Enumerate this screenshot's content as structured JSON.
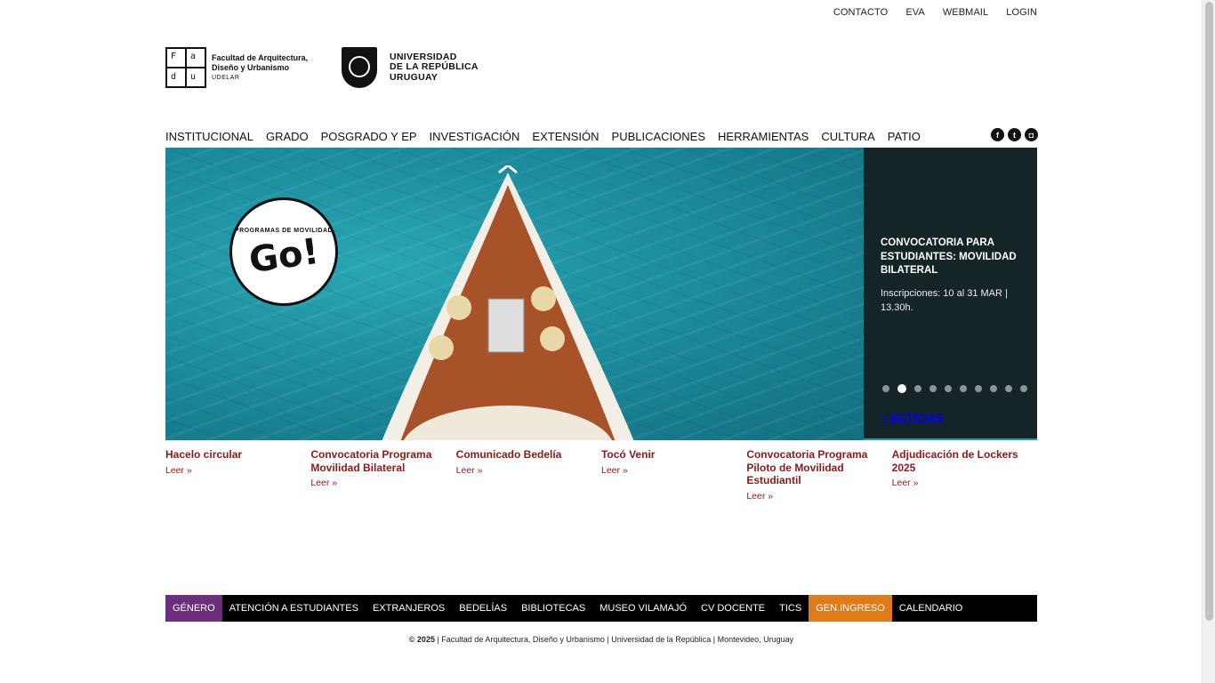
{
  "top_links": [
    "CONTACTO",
    "EVA",
    "WEBMAIL",
    "LOGIN"
  ],
  "logos": {
    "fadu_letters": [
      "F",
      "a",
      "d",
      "u"
    ],
    "fadu_name": "Facultad de Arquitectura, Diseño y Urbanismo",
    "fadu_sub": "UDELAR",
    "udelar_line1": "UNIVERSIDAD",
    "udelar_line2": "DE LA REPÚBLICA",
    "udelar_line3": "URUGUAY"
  },
  "main_nav": [
    "INSTITUCIONAL",
    "GRADO",
    "POSGRADO Y EP",
    "INVESTIGACIÓN",
    "EXTENSIÓN",
    "PUBLICACIONES",
    "HERRAMIENTAS",
    "CULTURA",
    "PATIO"
  ],
  "social": [
    {
      "icon": "facebook-icon",
      "glyph": "f"
    },
    {
      "icon": "twitter-icon",
      "glyph": "t"
    },
    {
      "icon": "instagram-icon",
      "glyph": "◘"
    }
  ],
  "hero": {
    "badge_small": "PROGRAMAS DE MOVILIDAD",
    "badge_big": "Go!",
    "title": "CONVOCATORIA PARA ESTUDIANTES: MOVILIDAD BILATERAL",
    "desc": "Inscripciones: 10 al 31 MAR | 13.30h.",
    "slide_count": 10,
    "active_slide": 2,
    "more_label": "+ NOTICIAS"
  },
  "news": [
    {
      "title": "Hacelo circular",
      "link": "Leer »"
    },
    {
      "title": "Convocatoria Programa Movilidad Bilateral",
      "link": "Leer »"
    },
    {
      "title": "Comunicado Bedelía",
      "link": "Leer »"
    },
    {
      "title": "Tocó Venir",
      "link": "Leer »"
    },
    {
      "title": "Convocatoria Programa Piloto de Movilidad Estudiantil",
      "link": "Leer »"
    },
    {
      "title": "Adjudicación de Lockers 2025",
      "link": "Leer »"
    }
  ],
  "footer_links": [
    "GÉNERO",
    "ATENCIÓN A ESTUDIANTES",
    "EXTRANJEROS",
    "BEDELÍAS",
    "BIBLIOTECAS",
    "MUSEO VILAMAJÓ",
    "CV DOCENTE",
    "TICS",
    "GEN.INGRESO",
    "CALENDARIO"
  ],
  "copyright": {
    "year": "© 2025",
    "text": " | Facultad de Arquitectura, Diseño y Urbanismo | Universidad de la República | Montevideo, Uruguay"
  },
  "colors": {
    "accent_link": "#8b1a1a",
    "genero_bg": "#6b2e7c",
    "ingreso_bg": "#e07b1a",
    "panel_bg": "#152427"
  }
}
